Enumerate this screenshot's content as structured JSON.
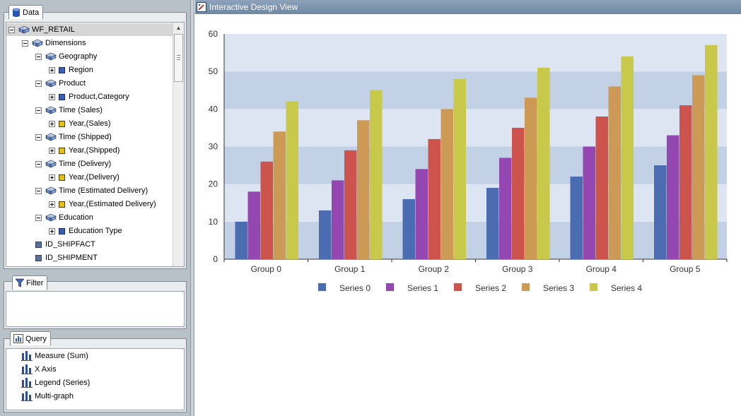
{
  "data_panel": {
    "tab_label": "Data",
    "tree": [
      {
        "label": "WF_RETAIL",
        "level": 0,
        "toggle": "minus",
        "icon": "cube-icon",
        "selected": true
      },
      {
        "label": "Dimensions",
        "level": 1,
        "toggle": "minus",
        "icon": "dimensions-icon"
      },
      {
        "label": "Geography",
        "level": 2,
        "toggle": "minus",
        "icon": "dimension-icon"
      },
      {
        "label": "Region",
        "level": 3,
        "toggle": "plus",
        "icon": "hierarchy-icon"
      },
      {
        "label": "Product",
        "level": 2,
        "toggle": "minus",
        "icon": "dimension-icon"
      },
      {
        "label": "Product,Category",
        "level": 3,
        "toggle": "plus",
        "icon": "hierarchy-icon"
      },
      {
        "label": "Time (Sales)",
        "level": 2,
        "toggle": "minus",
        "icon": "dimension-icon"
      },
      {
        "label": "Year,(Sales)",
        "level": 3,
        "toggle": "plus",
        "icon": "time-hierarchy-icon"
      },
      {
        "label": "Time (Shipped)",
        "level": 2,
        "toggle": "minus",
        "icon": "dimension-icon"
      },
      {
        "label": "Year,(Shipped)",
        "level": 3,
        "toggle": "plus",
        "icon": "time-hierarchy-icon"
      },
      {
        "label": "Time (Delivery)",
        "level": 2,
        "toggle": "minus",
        "icon": "dimension-icon"
      },
      {
        "label": "Year,(Delivery)",
        "level": 3,
        "toggle": "plus",
        "icon": "time-hierarchy-icon"
      },
      {
        "label": "Time (Estimated Delivery)",
        "level": 2,
        "toggle": "minus",
        "icon": "dimension-icon"
      },
      {
        "label": "Year,(Estimated Delivery)",
        "level": 3,
        "toggle": "plus",
        "icon": "time-hierarchy-icon"
      },
      {
        "label": "Education",
        "level": 2,
        "toggle": "minus",
        "icon": "dimension-icon"
      },
      {
        "label": "Education Type",
        "level": 3,
        "toggle": "plus",
        "icon": "hierarchy-icon"
      },
      {
        "label": "ID_SHIPFACT",
        "level": 2,
        "toggle": "none",
        "icon": "field-icon"
      },
      {
        "label": "ID_SHIPMENT",
        "level": 2,
        "toggle": "none",
        "icon": "field-icon"
      }
    ]
  },
  "filter_panel": {
    "tab_label": "Filter"
  },
  "query_panel": {
    "tab_label": "Query",
    "items": [
      {
        "label": "Measure (Sum)",
        "icon": "measure-bucket-icon"
      },
      {
        "label": "X Axis",
        "icon": "x-axis-bucket-icon"
      },
      {
        "label": "Legend (Series)",
        "icon": "legend-bucket-icon"
      },
      {
        "label": "Multi-graph",
        "icon": "multigraph-bucket-icon"
      }
    ]
  },
  "design_view": {
    "title": "Interactive Design View"
  },
  "colors": {
    "series": [
      "#4b6cb0",
      "#9447b0",
      "#cc544c",
      "#cc9a55",
      "#c8c84a"
    ],
    "band_light": "#dde5f3",
    "band_dark": "#c3d1e7",
    "titlebar": "#7e94b0"
  },
  "chart_data": {
    "type": "bar",
    "categories": [
      "Group 0",
      "Group 1",
      "Group 2",
      "Group 3",
      "Group 4",
      "Group 5"
    ],
    "series": [
      {
        "name": "Series 0",
        "values": [
          10,
          13,
          16,
          19,
          22,
          25
        ]
      },
      {
        "name": "Series 1",
        "values": [
          18,
          21,
          24,
          27,
          30,
          33
        ]
      },
      {
        "name": "Series 2",
        "values": [
          26,
          29,
          32,
          35,
          38,
          41
        ]
      },
      {
        "name": "Series 3",
        "values": [
          34,
          37,
          40,
          43,
          46,
          49
        ]
      },
      {
        "name": "Series 4",
        "values": [
          42,
          45,
          48,
          51,
          54,
          57
        ]
      }
    ],
    "yticks": [
      "0",
      "10",
      "20",
      "30",
      "40",
      "50",
      "60"
    ],
    "ylim": [
      0,
      60
    ],
    "legend_position": "bottom",
    "grid": "horizontal bands"
  }
}
